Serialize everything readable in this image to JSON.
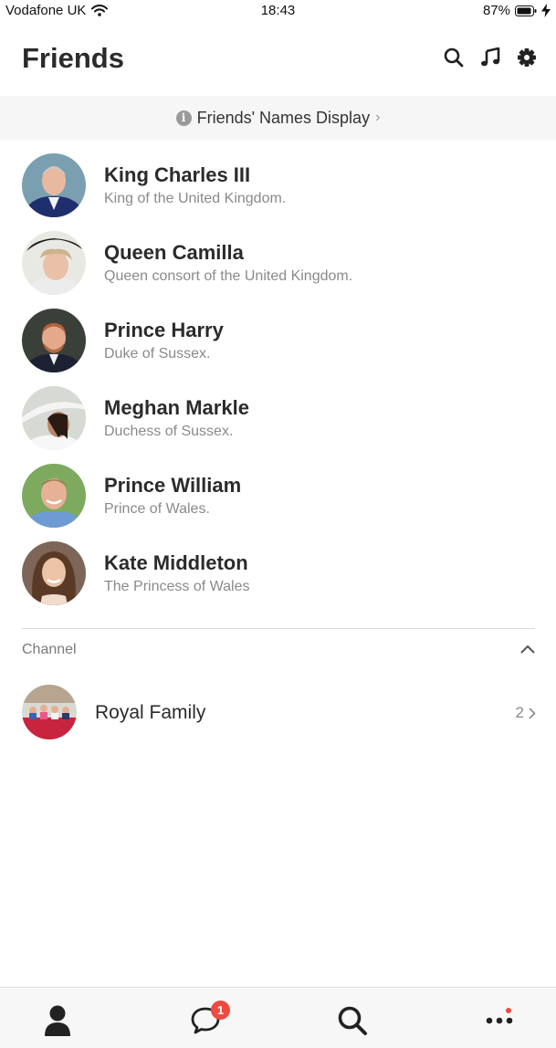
{
  "status_bar": {
    "carrier": "Vodafone UK",
    "time": "18:43",
    "battery": "87%"
  },
  "header": {
    "title": "Friends",
    "icons": [
      "search-icon",
      "music-note-icon",
      "gear-icon"
    ]
  },
  "names_display": {
    "label": "Friends' Names Display",
    "icon": "info-icon"
  },
  "friends": [
    {
      "name": "King Charles III",
      "description": "King of the United Kingdom."
    },
    {
      "name": "Queen Camilla",
      "description": "Queen consort of the United Kingdom."
    },
    {
      "name": "Prince Harry",
      "description": "Duke of Sussex."
    },
    {
      "name": "Meghan Markle",
      "description": "Duchess of Sussex."
    },
    {
      "name": "Prince William",
      "description": "Prince of Wales."
    },
    {
      "name": "Kate Middleton",
      "description": "The Princess of Wales"
    }
  ],
  "channel": {
    "section_label": "Channel",
    "items": [
      {
        "name": "Royal Family",
        "count": "2"
      }
    ]
  },
  "tab_bar": {
    "items": [
      "person-icon",
      "chat-bubble-icon",
      "search-icon",
      "more-icon"
    ],
    "chat_badge": "1"
  },
  "colors": {
    "badge": "#f0493e",
    "text": "#2b2b2b",
    "subtext": "#8a8a8a"
  }
}
